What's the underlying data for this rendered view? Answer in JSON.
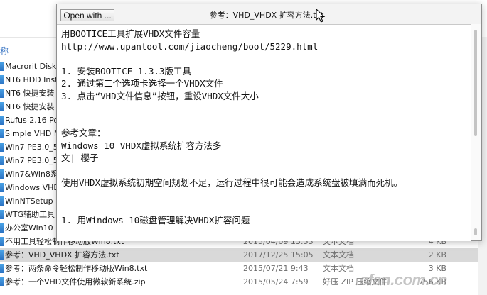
{
  "viewer": {
    "open_button": "Open with ...",
    "title": "参考：VHD_VHDX 扩容方法.txt",
    "lines": [
      "用BOOTICE工具扩展VHDX文件容量",
      "http://www.upantool.com/jiaocheng/boot/5229.html",
      "",
      "1. 安装BOOTICE 1.3.3版工具",
      "2. 通过第二个选项卡选择一个VHDX文件",
      "3. 点击“VHD文件信息”按钮，重设VHDX文件大小",
      "",
      "",
      "参考文章：",
      "Windows 10 VHDX虚拟系统扩容方法多",
      "文| 樱子",
      "",
      "使用VHDX虚拟系统初期空间规划不足，运行过程中很可能会造成系统盘被填满而死机。",
      "",
      "",
      "1. 用Windows 10磁盘管理解决VHDX扩容问题"
    ]
  },
  "explorer": {
    "side_header": "称",
    "files": [
      {
        "name": "Macrorit Disk",
        "date": "",
        "type": "",
        "size": "",
        "selected": false
      },
      {
        "name": "NT6 HDD Inst",
        "date": "",
        "type": "",
        "size": "",
        "selected": false
      },
      {
        "name": "NT6 快捷安装",
        "date": "",
        "type": "",
        "size": "",
        "selected": false
      },
      {
        "name": "NT6 快捷安装",
        "date": "",
        "type": "",
        "size": "",
        "selected": false
      },
      {
        "name": "Rufus 2.16 Po",
        "date": "",
        "type": "",
        "size": "",
        "selected": false
      },
      {
        "name": "Simple VHD M",
        "date": "",
        "type": "",
        "size": "",
        "selected": false
      },
      {
        "name": "Win7 PE3.0_5",
        "date": "",
        "type": "",
        "size": "",
        "selected": false
      },
      {
        "name": "Win7 PE3.0_5",
        "date": "",
        "type": "",
        "size": "",
        "selected": false
      },
      {
        "name": "Win7&Win8系",
        "date": "",
        "type": "",
        "size": "",
        "selected": false
      },
      {
        "name": "Windows VHD",
        "date": "",
        "type": "",
        "size": "",
        "selected": false
      },
      {
        "name": "WinNTSetup",
        "date": "",
        "type": "",
        "size": "",
        "selected": false
      },
      {
        "name": "WTG辅助工具",
        "date": "",
        "type": "",
        "size": "",
        "selected": false
      },
      {
        "name": "办公室Win10",
        "date": "",
        "type": "",
        "size": "",
        "selected": false
      },
      {
        "name": "不用工具轻松制作移动版Win8.txt",
        "date": "2015/04/09 13:53",
        "type": "文本文档",
        "size": "4 KB",
        "selected": false
      },
      {
        "name": "参考：VHD_VHDX 扩容方法.txt",
        "date": "2017/12/25 15:05",
        "type": "文本文档",
        "size": "2 KB",
        "selected": true
      },
      {
        "name": "参考：两条命令轻松制作移动版Win8.txt",
        "date": "2015/07/21 9:43",
        "type": "文本文档",
        "size": "3 KB",
        "selected": false
      },
      {
        "name": "参考：一个VHD文件使用微软新系统.zip",
        "date": "2015/05/24 7:59",
        "type": "好压 ZIP 压缩文件",
        "size": "756 KB",
        "selected": false
      }
    ]
  },
  "watermark": "cfan.com.cn"
}
